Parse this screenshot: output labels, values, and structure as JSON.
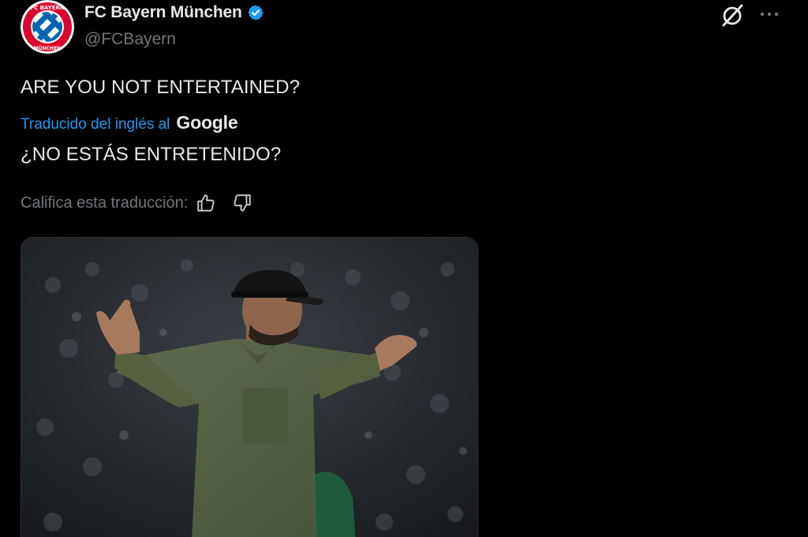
{
  "tweet": {
    "author": {
      "display_name": "FC Bayern München",
      "handle": "@FCBayern",
      "avatar_text_top": "FC BAYERN",
      "avatar_text_bottom": "MÜNCHEN"
    },
    "text_original": "ARE YOU NOT ENTERTAINED?",
    "translation": {
      "label": "Traducido del inglés al",
      "provider": "Google",
      "text": "¿NO ESTÁS ENTRETENIDO?"
    },
    "rating": {
      "label": "Califica esta traducción:"
    }
  },
  "icons": {
    "verified": "verified-badge-icon",
    "grok": "grok-icon",
    "more": "more-options-icon",
    "thumbs_up": "thumbs-up-icon",
    "thumbs_down": "thumbs-down-icon"
  },
  "colors": {
    "background": "#000000",
    "text_primary": "#e7e9ea",
    "text_secondary": "#71767b",
    "link": "#1d9bf0",
    "bayern_red": "#dc052d",
    "bayern_blue": "#0066b2"
  }
}
